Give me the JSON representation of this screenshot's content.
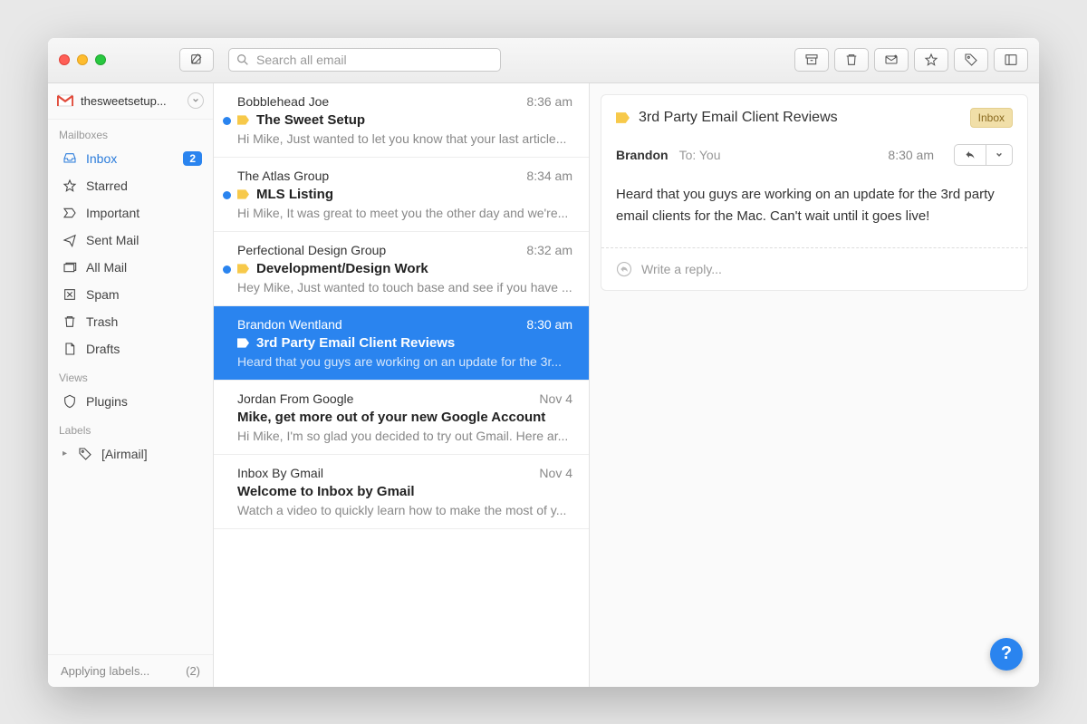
{
  "toolbar": {
    "search_placeholder": "Search all email"
  },
  "account": {
    "name": "thesweetsetup..."
  },
  "sidebar": {
    "sections": {
      "mailboxes": "Mailboxes",
      "views": "Views",
      "labels": "Labels"
    },
    "items": [
      {
        "label": "Inbox",
        "badge": "2"
      },
      {
        "label": "Starred"
      },
      {
        "label": "Important"
      },
      {
        "label": "Sent Mail"
      },
      {
        "label": "All Mail"
      },
      {
        "label": "Spam"
      },
      {
        "label": "Trash"
      },
      {
        "label": "Drafts"
      }
    ],
    "plugins": "Plugins",
    "label_airmail": "[Airmail]"
  },
  "footer": {
    "status": "Applying labels...",
    "count": "(2)"
  },
  "messages": [
    {
      "from": "Bobblehead Joe",
      "time": "8:36 am",
      "subject": "The Sweet Setup",
      "preview": "Hi Mike, Just wanted to let you know that your last article...",
      "unread": true
    },
    {
      "from": "The Atlas Group",
      "time": "8:34 am",
      "subject": "MLS Listing",
      "preview": "Hi Mike, It was great to meet you the other day and we're...",
      "unread": true
    },
    {
      "from": "Perfectional Design Group",
      "time": "8:32 am",
      "subject": "Development/Design Work",
      "preview": "Hey Mike, Just wanted to touch base and see if you have ...",
      "unread": true
    },
    {
      "from": "Brandon Wentland",
      "time": "8:30 am",
      "subject": "3rd Party Email Client Reviews",
      "preview": "Heard that you guys are working on an update for the 3r...",
      "unread": false
    },
    {
      "from": "Jordan From Google",
      "time": "Nov 4",
      "subject": "Mike, get more out of your new Google Account",
      "preview": "Hi Mike, I'm so glad you decided to try out Gmail. Here ar...",
      "unread": false
    },
    {
      "from": "Inbox By Gmail",
      "time": "Nov 4",
      "subject": "Welcome to Inbox by Gmail",
      "preview": "Watch a video to quickly learn how to make the most of y...",
      "unread": false
    }
  ],
  "detail": {
    "subject": "3rd Party Email Client Reviews",
    "tag": "Inbox",
    "from": "Brandon",
    "to": "To: You",
    "time": "8:30 am",
    "body": "Heard that you guys  are working on an update for the 3rd party email clients for the Mac.  Can't wait until it goes live!",
    "reply_placeholder": "Write a reply..."
  },
  "help": "?"
}
